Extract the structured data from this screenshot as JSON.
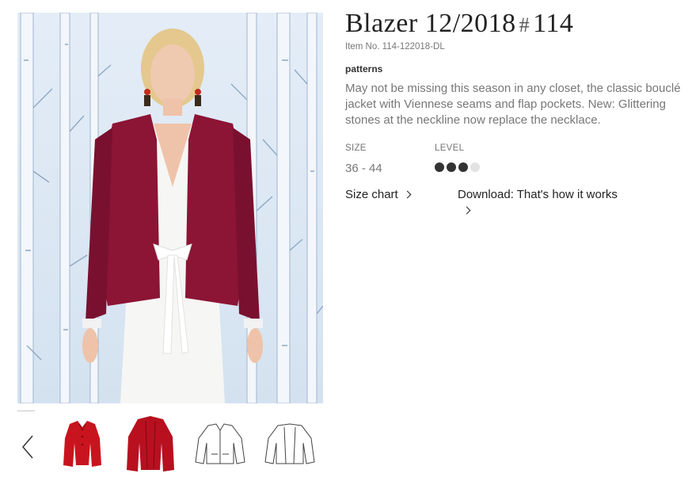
{
  "product": {
    "title_main": "Blazer 12/2018",
    "title_hash": "#",
    "title_number": "114",
    "item_no": "Item No. 114-122018-DL",
    "category": "patterns",
    "description": "May not be missing this season in any closet, the classic bouclé jacket with Viennese seams and flap pockets. New: Glittering stones at the neckline now replace the necklace."
  },
  "specs": {
    "size_label": "SIZE",
    "size_value": "36 - 44",
    "level_label": "LEVEL",
    "level_filled": 3,
    "level_total": 4
  },
  "links": {
    "size_chart": "Size chart",
    "download": "Download: That's how it works"
  },
  "gallery": {
    "thumbnails": [
      "jacket-front-photo",
      "jacket-back-photo",
      "front-line-drawing",
      "back-line-drawing"
    ]
  },
  "colors": {
    "jacket": "#8c1435",
    "thumb_jacket": "#c8141e",
    "background": "#dce8f4"
  }
}
